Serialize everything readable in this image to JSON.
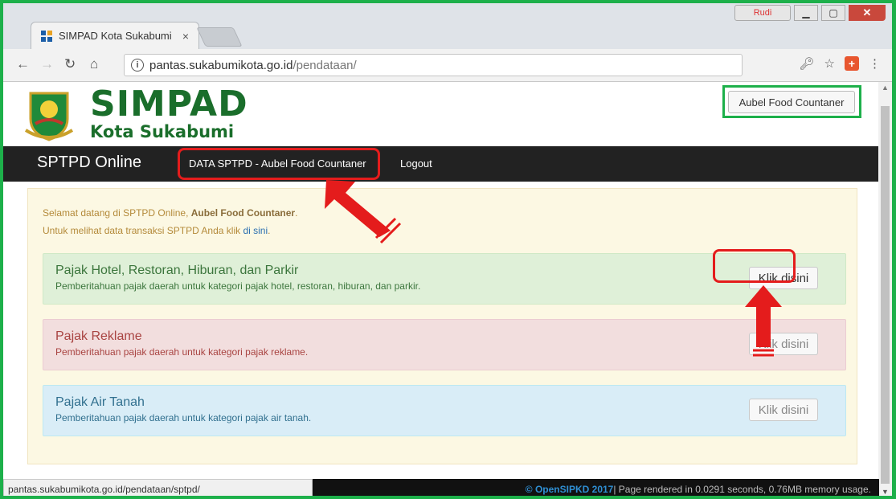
{
  "browser": {
    "tab_title": "SIMPAD Kota Sukabumi",
    "tab_close": "×",
    "user_label": "Rudi",
    "url_host": "pantas.sukabumikota.go.id",
    "url_path": "/pendataan/"
  },
  "header": {
    "brand_line1": "SIMPAD",
    "brand_line2": "Kota Sukabumi",
    "user_button": "Aubel Food Countaner"
  },
  "nav": {
    "brand": "SPTPD Online",
    "link_data": "DATA SPTPD - Aubel Food Countaner",
    "link_logout": "Logout"
  },
  "welcome": {
    "line1_prefix": "Selamat datang di SPTPD Online, ",
    "line1_name": "Aubel Food Countaner",
    "line1_suffix": ".",
    "line2_prefix": "Untuk melihat data transaksi SPTPD Anda klik ",
    "line2_link": "di sini",
    "line2_suffix": "."
  },
  "categories": [
    {
      "title": "Pajak Hotel, Restoran, Hiburan, dan Parkir",
      "desc": "Pemberitahuan pajak daerah untuk kategori pajak hotel, restoran, hiburan, dan parkir.",
      "button": "Klik disini"
    },
    {
      "title": "Pajak Reklame",
      "desc": "Pemberitahuan pajak daerah untuk kategori pajak reklame.",
      "button": "Klik disini"
    },
    {
      "title": "Pajak Air Tanah",
      "desc": "Pemberitahuan pajak daerah untuk kategori pajak air tanah.",
      "button": "Klik disini"
    }
  ],
  "status": {
    "hover_url": "pantas.sukabumikota.go.id/pendataan/sptpd/",
    "footer_brand": "© OpenSIPKD 2017",
    "footer_text": " | Page rendered in 0.0291 seconds, 0.76MB memory usage."
  },
  "colors": {
    "highlight_green": "#1db04a",
    "highlight_red": "#e41c1c",
    "brand_green": "#1a6e2b"
  }
}
